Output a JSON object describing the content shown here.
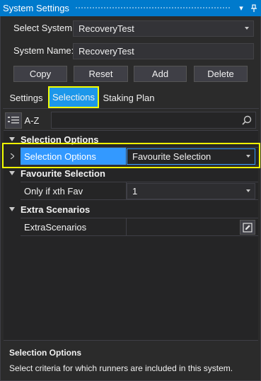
{
  "window": {
    "title": "System Settings"
  },
  "header": {
    "select_system_label": "Select System:",
    "select_system_value": "RecoveryTest",
    "system_name_label": "System Name:",
    "system_name_value": "RecoveryTest"
  },
  "buttons": {
    "copy": "Copy",
    "reset": "Reset",
    "add": "Add",
    "delete": "Delete"
  },
  "tabs": [
    {
      "label": "Settings",
      "active": false
    },
    {
      "label": "Selections",
      "active": true
    },
    {
      "label": "Staking Plan",
      "active": false
    }
  ],
  "toolbar": {
    "az_label": "A-Z",
    "search_placeholder": ""
  },
  "grid": {
    "categories": [
      {
        "name": "Selection Options",
        "rows": [
          {
            "name": "Selection Options",
            "value": "Favourite Selection",
            "selected": true
          }
        ]
      },
      {
        "name": "Favourite Selection",
        "rows": [
          {
            "name": "Only if xth Fav",
            "value": "1"
          }
        ]
      },
      {
        "name": "Extra Scenarios",
        "rows": [
          {
            "name": "ExtraScenarios",
            "value": ""
          }
        ]
      }
    ]
  },
  "description": {
    "title": "Selection Options",
    "text": "Select criteria for which runners are included in this system."
  },
  "colors": {
    "accent": "#007acc",
    "selection": "#3399ff",
    "highlight": "#f2ff00",
    "background": "#2b2b2b"
  }
}
